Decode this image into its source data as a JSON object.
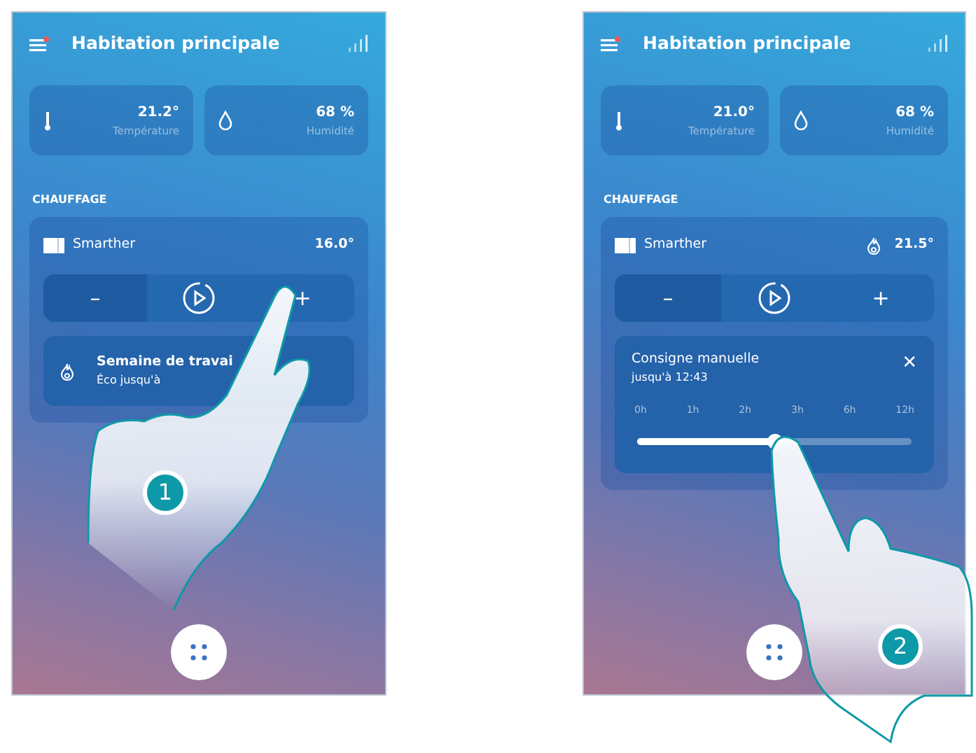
{
  "screens": [
    {
      "title": "Habitation principale",
      "sensors": [
        {
          "kind": "temperature",
          "value": "21.2°",
          "label": "Température"
        },
        {
          "kind": "humidity",
          "value": "68 %",
          "label": "Humidité"
        }
      ],
      "section": "CHAUFFAGE",
      "device": {
        "name": "Smarther",
        "setpoint": "16.0°",
        "heating": false
      },
      "controls": {
        "minus": "–",
        "plus": "+"
      },
      "panel": {
        "kind": "program",
        "title": "Semaine de travai",
        "subtitle": "Éco jusqu'à"
      },
      "step": "1"
    },
    {
      "title": "Habitation principale",
      "sensors": [
        {
          "kind": "temperature",
          "value": "21.0°",
          "label": "Température"
        },
        {
          "kind": "humidity",
          "value": "68 %",
          "label": "Humidité"
        }
      ],
      "section": "CHAUFFAGE",
      "device": {
        "name": "Smarther",
        "setpoint": "21.5°",
        "heating": true
      },
      "controls": {
        "minus": "–",
        "plus": "+"
      },
      "panel": {
        "kind": "manual",
        "title": "Consigne manuelle",
        "subtitle": "jusqu'à 12:43",
        "close": "✕",
        "ticks": [
          "0h",
          "1h",
          "2h",
          "3h",
          "6h",
          "12h"
        ],
        "level": 0.5
      },
      "step": "2"
    }
  ]
}
